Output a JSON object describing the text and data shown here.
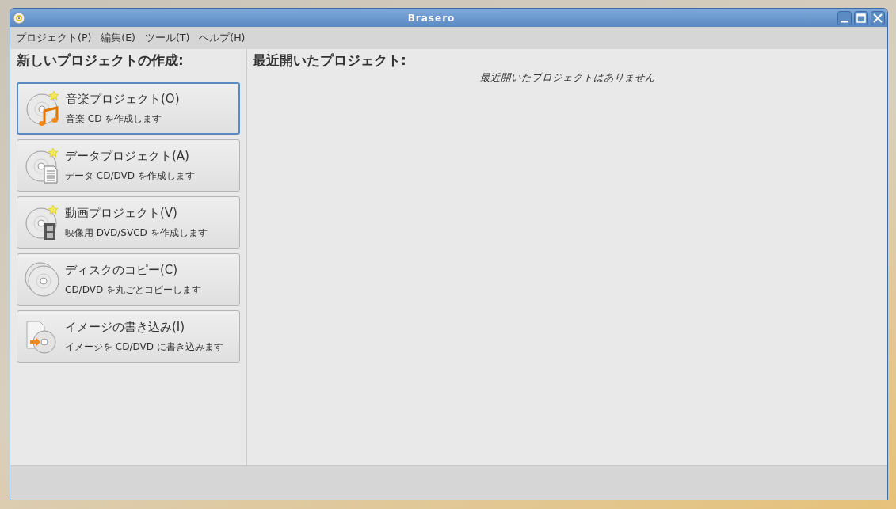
{
  "window": {
    "title": "Brasero"
  },
  "menu": [
    {
      "label": "プロジェクト(P)"
    },
    {
      "label": "編集(E)"
    },
    {
      "label": "ツール(T)"
    },
    {
      "label": "ヘルプ(H)"
    }
  ],
  "new_project": {
    "heading": "新しいプロジェクトの作成:",
    "items": [
      {
        "kind": "music",
        "title": "音楽プロジェクト(O)",
        "description": "音楽 CD を作成します",
        "selected": true
      },
      {
        "kind": "data",
        "title": "データプロジェクト(A)",
        "description": "データ CD/DVD を作成します",
        "selected": false
      },
      {
        "kind": "video",
        "title": "動画プロジェクト(V)",
        "description": "映像用 DVD/SVCD を作成します",
        "selected": false
      },
      {
        "kind": "copy",
        "title": "ディスクのコピー(C)",
        "description": "CD/DVD を丸ごとコピーします",
        "selected": false
      },
      {
        "kind": "image",
        "title": "イメージの書き込み(I)",
        "description": "イメージを CD/DVD に書き込みます",
        "selected": false
      }
    ]
  },
  "recent": {
    "heading": "最近開いたプロジェクト:",
    "empty_message": "最近開いたプロジェクトはありません"
  }
}
